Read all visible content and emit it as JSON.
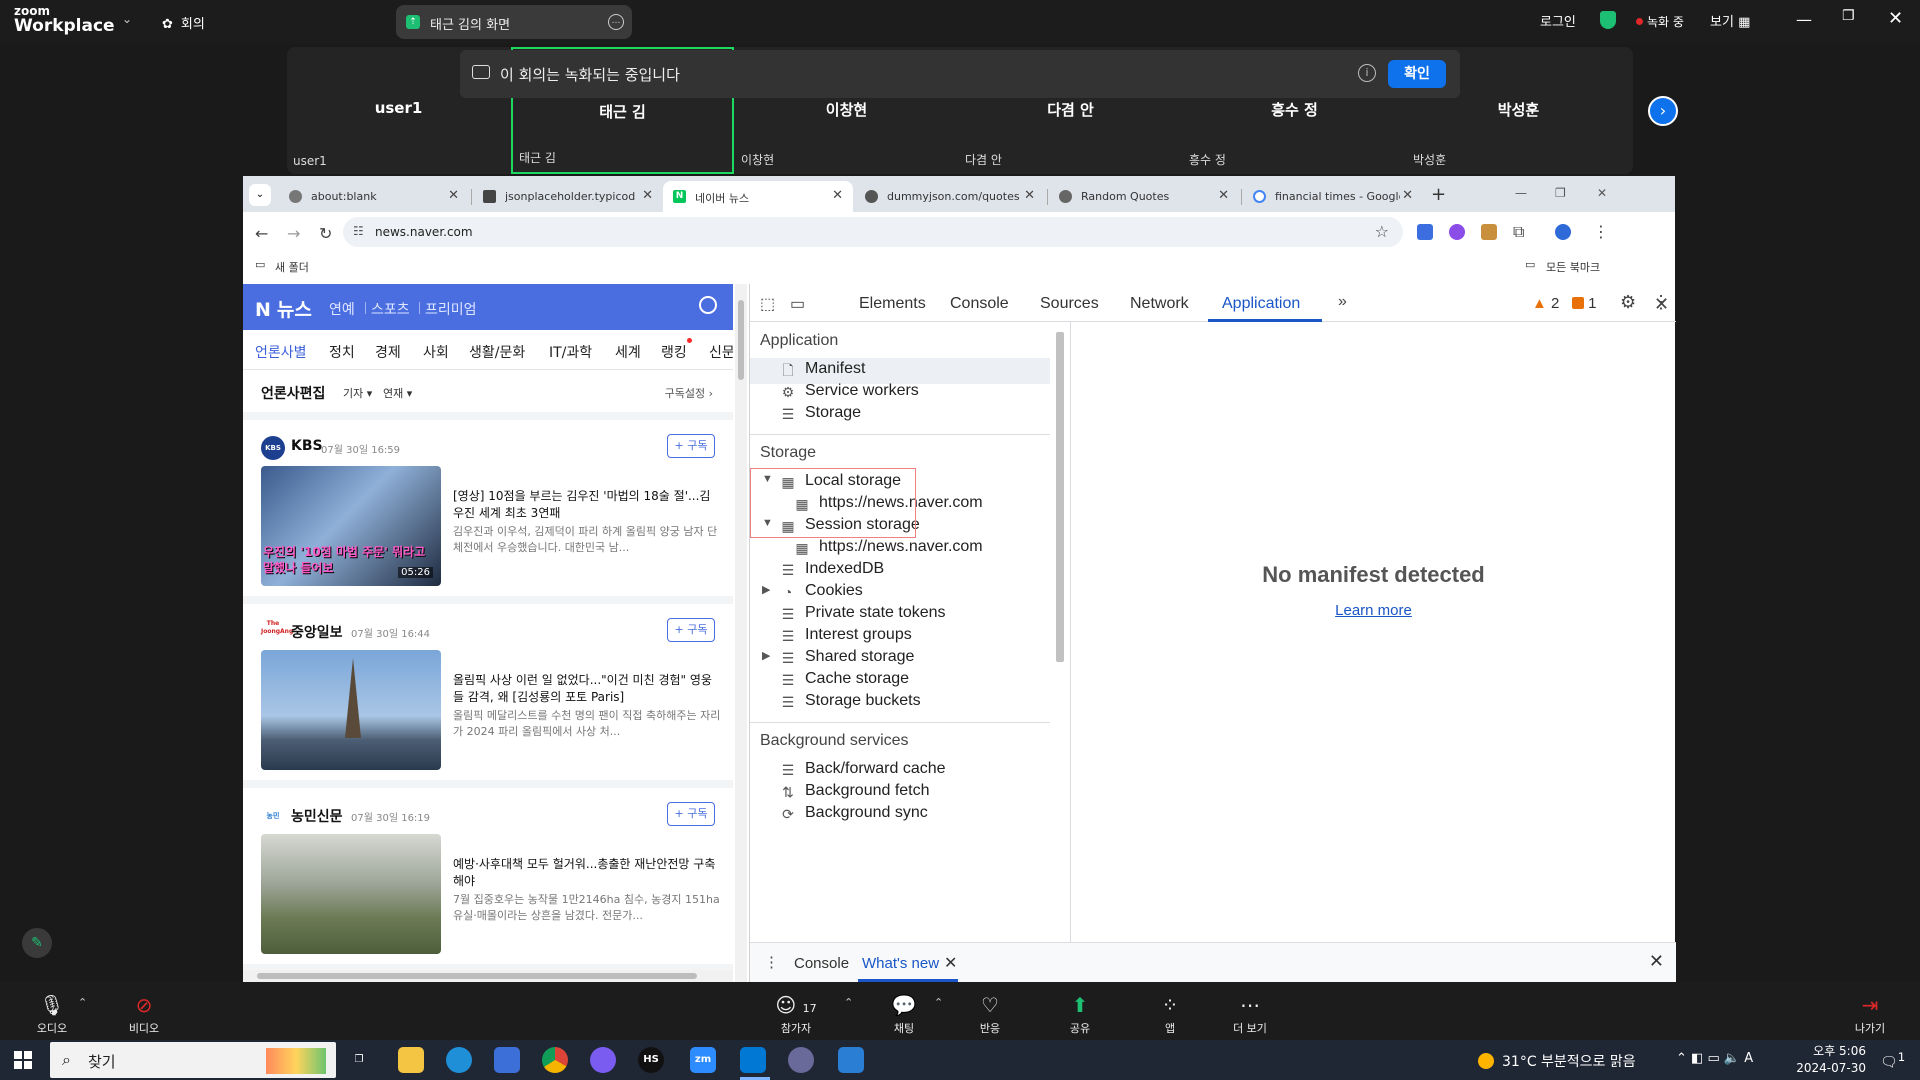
{
  "zoom": {
    "logo_line1": "zoom",
    "logo_line2": "Workplace",
    "meeting_label": "회의",
    "share_title": "태근 김의 화면",
    "login": "로그인",
    "recording": "녹화 중",
    "view": "보기",
    "recording_banner": "이 회의는 녹화되는 중입니다",
    "confirm": "확인",
    "participants": [
      {
        "name": "user1",
        "sub": "user1"
      },
      {
        "name": "태근 김",
        "sub": "태근 김"
      },
      {
        "name": "이창현",
        "sub": "이창현"
      },
      {
        "name": "다겸 안",
        "sub": "다겸 안"
      },
      {
        "name": "흥수 정",
        "sub": "흥수 정"
      },
      {
        "name": "박성훈",
        "sub": "박성훈"
      }
    ],
    "bottom": {
      "audio": "오디오",
      "video": "비디오",
      "participants": "참가자",
      "participants_count": "17",
      "chat": "채팅",
      "reactions": "반응",
      "share": "공유",
      "apps": "앱",
      "more": "더 보기",
      "leave": "나가기"
    }
  },
  "browser": {
    "tabs": [
      {
        "title": "about:blank"
      },
      {
        "title": "jsonplaceholder.typicode"
      },
      {
        "title": "네이버 뉴스"
      },
      {
        "title": "dummyjson.com/quotes"
      },
      {
        "title": "Random Quotes"
      },
      {
        "title": "financial times - Google"
      }
    ],
    "url": "news.naver.com",
    "bookmark_folder": "새 폴더",
    "all_bookmarks": "모든 북마크"
  },
  "naver": {
    "logo": "뉴스",
    "header_links": [
      "연예",
      "스포츠",
      "프리미엄"
    ],
    "categories": [
      "언론사별",
      "정치",
      "경제",
      "사회",
      "생활/문화",
      "IT/과학",
      "세계",
      "랭킹",
      "신문"
    ],
    "edit_title": "언론사편집",
    "filter1": "기자",
    "filter2": "연재",
    "subscribe_settings": "구독설정",
    "subscribe_btn": "+ 구독",
    "cards": [
      {
        "publisher": "KBS",
        "time": "07월 30일 16:59",
        "headline": "[영상] 10점을 부르는 김우진 '마법의 18술 절'...김우진 세계 최초 3연패",
        "snippet": "김우진과 이우석, 김제덕이 파리 하계 올림픽 양궁 남자 단체전에서 우승했습니다. 대한민국 남...",
        "thumb_caption": "우진의 '10점 마법 주문' 뭐라고 말했나 들어보",
        "duration": "05:26",
        "logo_text": "KBS NEWS"
      },
      {
        "publisher": "중앙일보",
        "time": "07월 30일 16:44",
        "headline": "올림픽 사상 이런 일 없었다...\"이건 미친 경험\" 영웅들 감격, 왜 [김성룡의 포토 Paris]",
        "snippet": "올림픽 메달리스트를 수천 명의 팬이 직접 축하해주는 자리가 2024 파리 올림픽에서 사상 처...",
        "logo_text": "The JoongAng"
      },
      {
        "publisher": "농민신문",
        "time": "07월 30일 16:19",
        "headline": "예방·사후대책 모두 헐거워...총출한 재난안전망 구축해야",
        "snippet": "7월 집중호우는 농작물 1만2146ha 침수, 농경지 151ha 유실·매몰이라는 상흔을 남겼다. 전문가...",
        "logo_text": "농민"
      }
    ]
  },
  "devtools": {
    "tabs": [
      "Elements",
      "Console",
      "Sources",
      "Network",
      "Application"
    ],
    "warnings": "2",
    "issues": "1",
    "sections": {
      "application": "Application",
      "storage": "Storage",
      "background": "Background services"
    },
    "app_items": [
      "Manifest",
      "Service workers",
      "Storage"
    ],
    "storage_items": {
      "local": "Local storage",
      "local_origin": "https://news.naver.com",
      "session": "Session storage",
      "session_origin": "https://news.naver.com",
      "indexeddb": "IndexedDB",
      "cookies": "Cookies",
      "private_state": "Private state tokens",
      "interest": "Interest groups",
      "shared": "Shared storage",
      "cache": "Cache storage",
      "buckets": "Storage buckets"
    },
    "bg_items": [
      "Back/forward cache",
      "Background fetch",
      "Background sync"
    ],
    "no_manifest": "No manifest detected",
    "learn_more": "Learn more",
    "drawer_console": "Console",
    "drawer_whatsnew": "What's new"
  },
  "taskbar": {
    "search": "찾기",
    "weather": "31°C  부분적으로 맑음",
    "ime": "A",
    "time": "오후 5:06",
    "date": "2024-07-30",
    "notif": "1"
  },
  "colors": {
    "zoom_blue": "#0e72ed",
    "naver_blue": "#4a6ee0",
    "devtools_blue": "#1a56c6",
    "highlight": "#f08080"
  }
}
